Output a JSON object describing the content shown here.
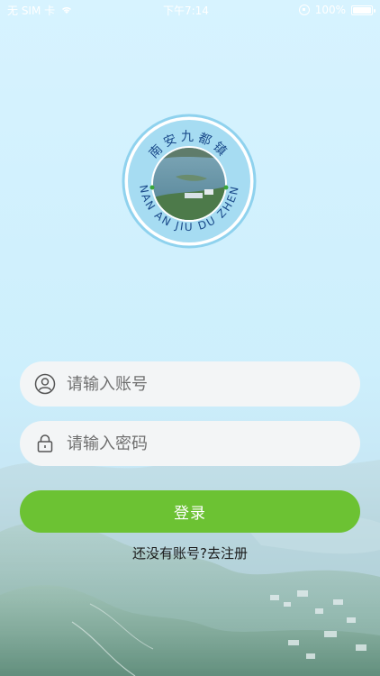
{
  "status_bar": {
    "carrier": "无 SIM 卡",
    "time": "下午7:14",
    "battery": "100%",
    "icons": [
      "wifi-icon",
      "rotation-lock-icon",
      "battery-icon"
    ]
  },
  "logo": {
    "top_text": "南安九都镇",
    "bottom_text": "NAN AN JIU DU ZHEN"
  },
  "login_form": {
    "account_placeholder": "请输入账号",
    "password_placeholder": "请输入密码",
    "account_icon": "user-icon",
    "password_icon": "lock-icon",
    "login_label": "登录",
    "register_text": "还没有账号?去注册"
  },
  "colors": {
    "accent": "#6cc233",
    "background_top": "#d7f3ff",
    "logo_ring": "#8fd2ee",
    "logo_text": "#1a4a8a"
  }
}
